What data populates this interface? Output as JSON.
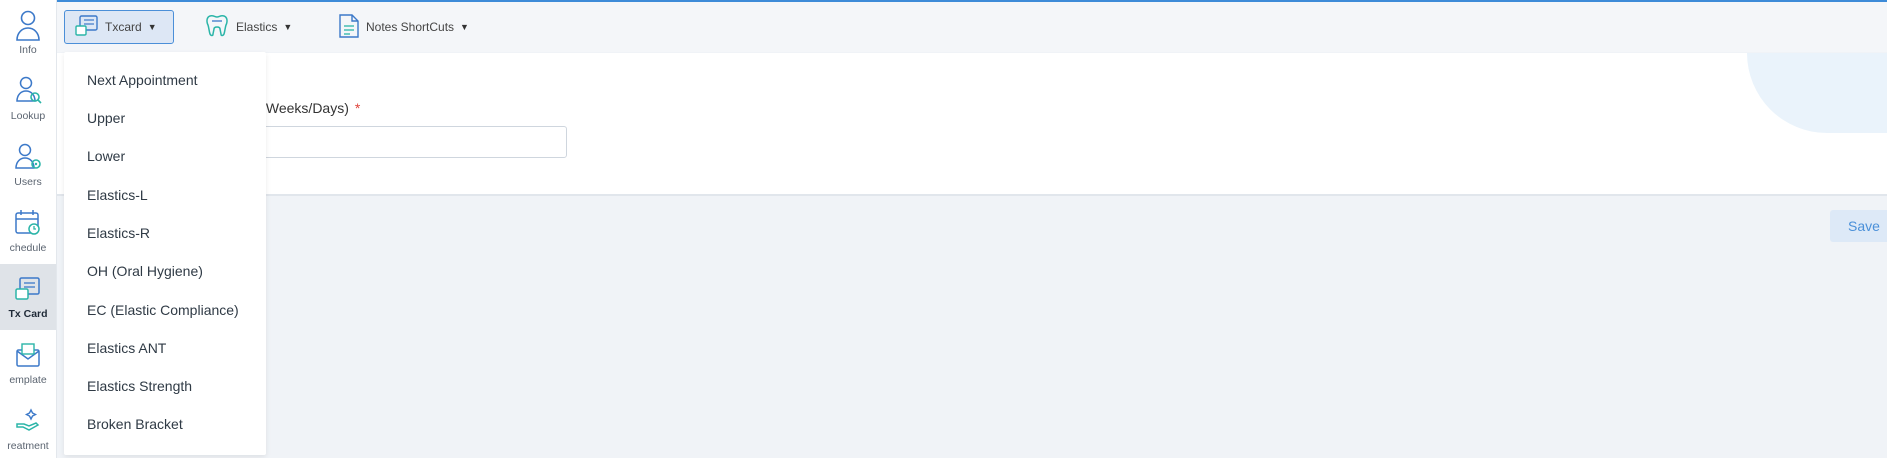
{
  "sidebar": {
    "items": [
      {
        "label": "Info",
        "icon": "person-icon"
      },
      {
        "label": "Lookup",
        "icon": "user-search-icon"
      },
      {
        "label": "Users",
        "icon": "user-gear-icon"
      },
      {
        "label": "chedule",
        "icon": "calendar-icon"
      },
      {
        "label": "Tx Card",
        "icon": "tx-card-icon",
        "active": true
      },
      {
        "label": "emplate",
        "icon": "envelope-icon"
      },
      {
        "label": "reatment",
        "icon": "hand-sparkle-icon"
      }
    ]
  },
  "toolbar": {
    "txcard_label": "Txcard",
    "elastics_label": "Elastics",
    "notes_label": "Notes ShortCuts"
  },
  "form": {
    "field_label": "/Weeks/Days)",
    "required_mark": "*",
    "field_value": ""
  },
  "actions": {
    "save_label": "Save"
  },
  "dropdown": {
    "items": [
      "Next Appointment",
      "Upper",
      "Lower",
      "Elastics-L",
      "Elastics-R",
      "OH (Oral Hygiene)",
      "EC (Elastic Compliance)",
      "Elastics ANT",
      "Elastics Strength",
      "Broken Bracket"
    ]
  },
  "colors": {
    "accent": "#3d8bd8",
    "icon_teal": "#2bb5a8",
    "icon_blue": "#3c79c9",
    "required": "#e0443c"
  }
}
